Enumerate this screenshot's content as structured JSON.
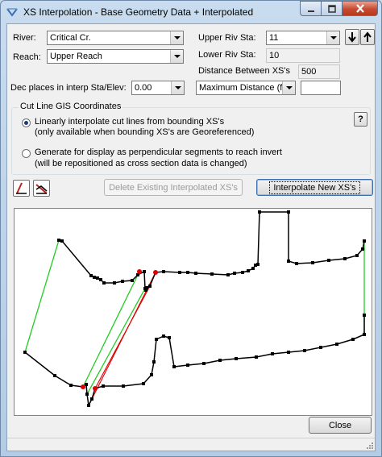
{
  "window": {
    "title": "XS Interpolation  - Base Geometry Data + Interpolated",
    "minimize_icon": "minimize-icon",
    "maximize_icon": "maximize-icon",
    "close_icon": "close-icon"
  },
  "form": {
    "river_label": "River:",
    "river_value": "Critical Cr.",
    "reach_label": "Reach:",
    "reach_value": "Upper Reach",
    "upper_sta_label": "Upper Riv Sta:",
    "upper_sta_value": "11",
    "lower_sta_label": "Lower Riv Sta:",
    "lower_sta_value": "10",
    "distance_label": "Distance Between XS's",
    "distance_value": "500",
    "dec_places_label": "Dec places in interp Sta/Elev:",
    "dec_places_value": "0.00",
    "max_distance_value": "Maximum Distance (ft)",
    "max_distance_input": ""
  },
  "cutline": {
    "group_title": "Cut Line GIS Coordinates",
    "option1_line1": "Linearly interpolate cut lines from bounding XS's",
    "option1_line2": "(only available when bounding XS's are Georeferenced)",
    "option2_line1": "Generate for display as perpendicular segments to reach invert",
    "option2_line2": "(will be repositioned as cross section data is changed)",
    "selected": 1,
    "help_label": "?"
  },
  "toolbar": {
    "delete_label": "Delete Existing Interpolated XS's",
    "interpolate_label": "Interpolate New XS's",
    "close_label": "Close"
  },
  "colors": {
    "upper_xs": "#000000",
    "lower_xs": "#000000",
    "green_link": "#22cc22",
    "red_link": "#dd0000",
    "red_point": "#dd0000"
  }
}
